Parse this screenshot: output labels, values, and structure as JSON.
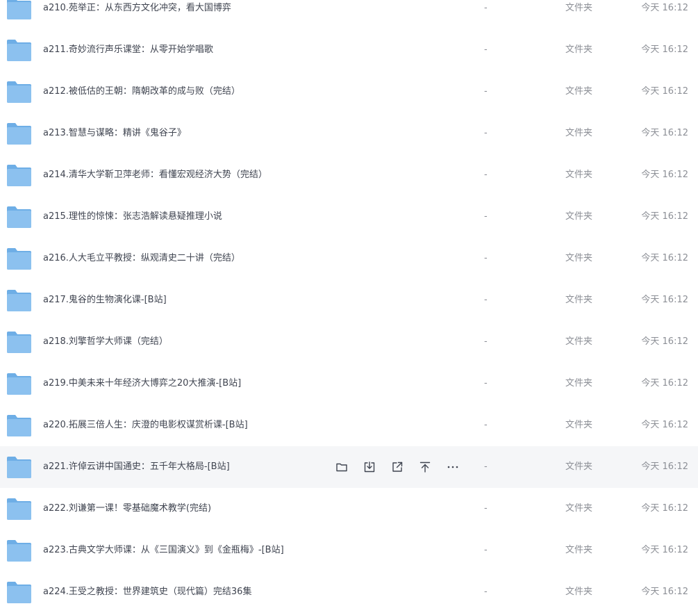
{
  "file_list": {
    "rows": [
      {
        "name": "a210.苑举正：从东西方文化冲突，看大国博弈",
        "size": "-",
        "type": "文件夹",
        "time": "今天 16:12"
      },
      {
        "name": "a211.奇妙流行声乐课堂：从零开始学唱歌",
        "size": "-",
        "type": "文件夹",
        "time": "今天 16:12"
      },
      {
        "name": "a212.被低估的王朝：隋朝改革的成与败（完结）",
        "size": "-",
        "type": "文件夹",
        "time": "今天 16:12"
      },
      {
        "name": "a213.智慧与谋略：精讲《鬼谷子》",
        "size": "-",
        "type": "文件夹",
        "time": "今天 16:12"
      },
      {
        "name": "a214.清华大学靳卫萍老师：看懂宏观经济大势（完结）",
        "size": "-",
        "type": "文件夹",
        "time": "今天 16:12"
      },
      {
        "name": "a215.理性的惊悚：张志浩解读悬疑推理小说",
        "size": "-",
        "type": "文件夹",
        "time": "今天 16:12"
      },
      {
        "name": "a216.人大毛立平教授：纵观清史二十讲（完结）",
        "size": "-",
        "type": "文件夹",
        "time": "今天 16:12"
      },
      {
        "name": "a217.鬼谷的生物演化课-[B站]",
        "size": "-",
        "type": "文件夹",
        "time": "今天 16:12"
      },
      {
        "name": "a218.刘擎哲学大师课（完结）",
        "size": "-",
        "type": "文件夹",
        "time": "今天 16:12"
      },
      {
        "name": "a219.中美未来十年经济大博弈之20大推演-[B站]",
        "size": "-",
        "type": "文件夹",
        "time": "今天 16:12"
      },
      {
        "name": "a220.拓展三倍人生：庆澄的电影权谋赏析课-[B站]",
        "size": "-",
        "type": "文件夹",
        "time": "今天 16:12"
      },
      {
        "name": "a221.许倬云讲中国通史：五千年大格局-[B站]",
        "size": "-",
        "type": "文件夹",
        "time": "今天 16:12"
      },
      {
        "name": "a222.刘谦第一课！零基础魔术教学(完结)",
        "size": "-",
        "type": "文件夹",
        "time": "今天 16:12"
      },
      {
        "name": "a223.古典文学大师课：从《三国演义》到《金瓶梅》-[B站]",
        "size": "-",
        "type": "文件夹",
        "time": "今天 16:12"
      },
      {
        "name": "a224.王受之教授：世界建筑史（现代篇）完结36集",
        "size": "-",
        "type": "文件夹",
        "time": "今天 16:12"
      }
    ]
  },
  "hover_actions": {
    "icons": [
      "folder-icon",
      "download-icon",
      "share-icon",
      "pin-top-icon",
      "more-icon"
    ]
  },
  "colors": {
    "folder_body": "#8cc1ef",
    "folder_tab": "#6eaee6",
    "hover_background": "#f5f6f8",
    "name_text": "#3f4450",
    "meta_text": "#8c8f96",
    "action_icon": "#3f4450"
  }
}
